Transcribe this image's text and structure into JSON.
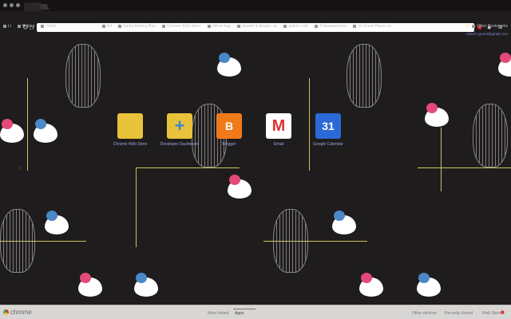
{
  "bookmarks": [
    "Li",
    "Writing",
    "Chick",
    "Art",
    "Santa Monica Bye",
    "Chrome Web Store",
    "Velvet bag",
    "Jewish & design, an",
    "gallon / ukr",
    "Thisisawesome",
    "10 Great Places to",
    "Other Bookmarks"
  ],
  "user_email": "citizen.t.guest@gmail.com",
  "apps": [
    {
      "label": "Chrome Web Store",
      "color": "#e8c23a",
      "glyph": ""
    },
    {
      "label": "Developer Dashboard",
      "color": "#e8c23a",
      "glyph": "+"
    },
    {
      "label": "Blogger",
      "color": "#f07a1a",
      "glyph": "B"
    },
    {
      "label": "Gmail",
      "color": "#ffffff",
      "glyph": "M"
    },
    {
      "label": "Google Calendar",
      "color": "#2a6ad8",
      "glyph": "31"
    }
  ],
  "footer": {
    "brand": "chrome",
    "tabs": [
      "Most visited",
      "Apps"
    ],
    "links": [
      "Other devices",
      "Recently closed",
      "Web Store"
    ]
  }
}
